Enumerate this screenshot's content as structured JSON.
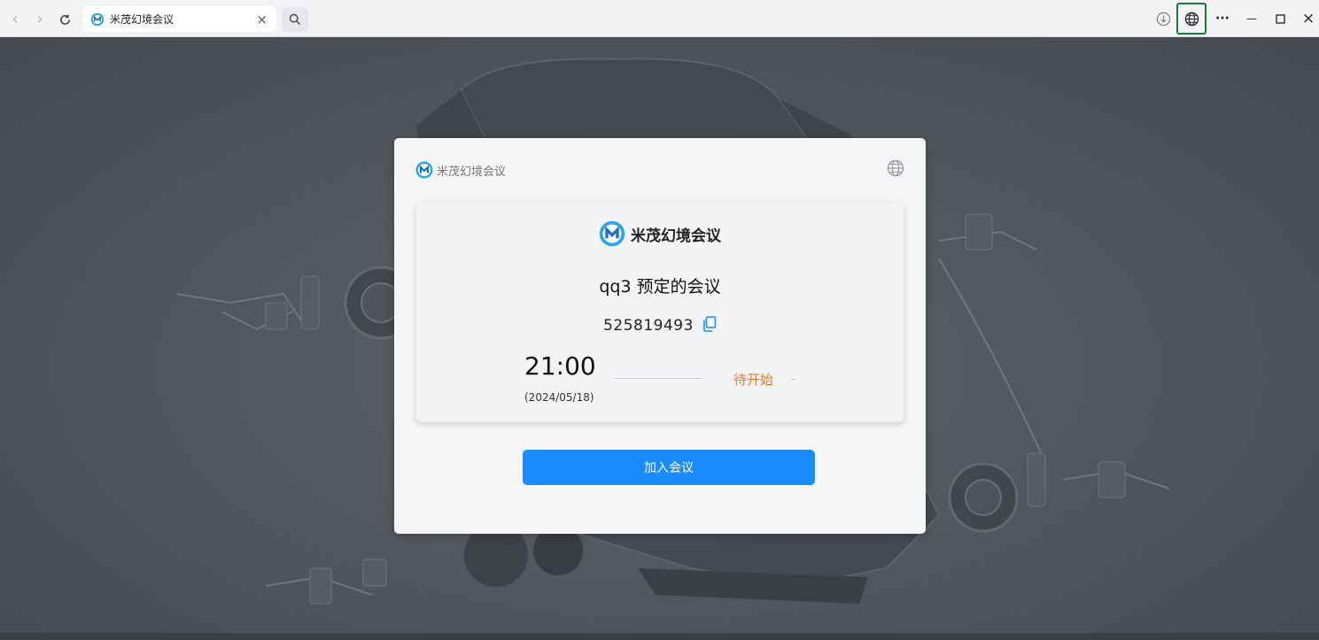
{
  "browser": {
    "tab_title": "米茂幻境会议",
    "tab_close": "×",
    "back": "‹",
    "forward": "›",
    "more": "···",
    "minimize": "—",
    "close": "×"
  },
  "card": {
    "header_title": "米茂幻境会议",
    "brand_name": "米茂幻境会议",
    "meeting_title": "qq3 预定的会议",
    "meeting_id": "525819493",
    "start_time": "21:00",
    "start_date": "(2024/05/18)",
    "status": "待开始",
    "join_label": "加入会议"
  },
  "colors": {
    "accent": "#1a8cff",
    "status": "#f07a2a",
    "globe_highlight": "#1a7a3a"
  }
}
